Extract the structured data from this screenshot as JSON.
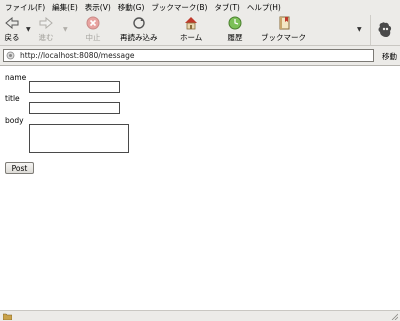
{
  "menubar": {
    "items": [
      "ファイル(F)",
      "編集(E)",
      "表示(V)",
      "移動(G)",
      "ブックマーク(B)",
      "タブ(T)",
      "ヘルプ(H)"
    ]
  },
  "toolbar": {
    "back": "戻る",
    "forward": "進む",
    "stop": "中止",
    "reload": "再読み込み",
    "home": "ホーム",
    "history": "履歴",
    "bookmarks": "ブックマーク"
  },
  "address": {
    "url": "http://localhost:8080/message",
    "go_label": "移動"
  },
  "form": {
    "name_label": "name",
    "title_label": "title",
    "body_label": "body",
    "name_value": "",
    "title_value": "",
    "body_value": "",
    "submit_label": "Post"
  },
  "colors": {
    "chrome": "#ecebe8",
    "stop_icon": "#d9534f",
    "history_icon": "#5a9e3a"
  }
}
